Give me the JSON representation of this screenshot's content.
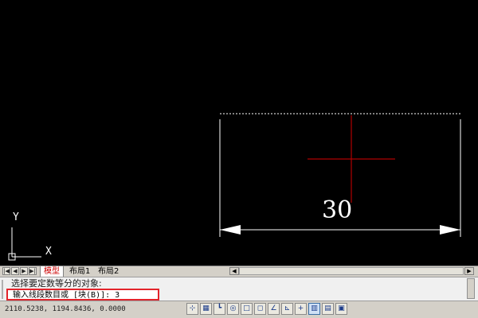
{
  "layout_tabs": {
    "model": "模型",
    "layout1": "布局1",
    "layout2": "布局2"
  },
  "nav_buttons": [
    "|◀",
    "◀",
    "▶",
    "▶|"
  ],
  "drawing": {
    "dimension_value": "30",
    "ucs_x_label": "X",
    "ucs_y_label": "Y",
    "colors": {
      "background": "#000000",
      "lines": "#ffffff",
      "crosshair": "#b00000"
    }
  },
  "command_line": {
    "history": "选择要定数等分的对象:",
    "prompt": "输入线段数目或 [块(B)]: 3",
    "highlight_color": "#e3242b"
  },
  "status_bar": {
    "coordinates": "2110.5238, 1194.8436, 0.0000",
    "toggles": [
      {
        "icon": "snap-icon",
        "glyph": "⊹",
        "on": false
      },
      {
        "icon": "grid-icon",
        "glyph": "▦",
        "on": false
      },
      {
        "icon": "ortho-icon",
        "glyph": "┗",
        "on": false
      },
      {
        "icon": "polar-icon",
        "glyph": "◎",
        "on": false
      },
      {
        "icon": "osnap-icon",
        "glyph": "□",
        "on": false
      },
      {
        "icon": "otrack-icon",
        "glyph": "◻",
        "on": false
      },
      {
        "icon": "ducs-icon",
        "glyph": "∠",
        "on": false
      },
      {
        "icon": "dyn-icon",
        "glyph": "⊾",
        "on": false
      },
      {
        "icon": "lineweight-icon",
        "glyph": "+",
        "on": false
      },
      {
        "icon": "transparency-icon",
        "glyph": "▥",
        "on": true
      },
      {
        "icon": "quickprops-icon",
        "glyph": "▤",
        "on": false
      },
      {
        "icon": "selection-cycling-icon",
        "glyph": "▣",
        "on": false
      }
    ]
  }
}
